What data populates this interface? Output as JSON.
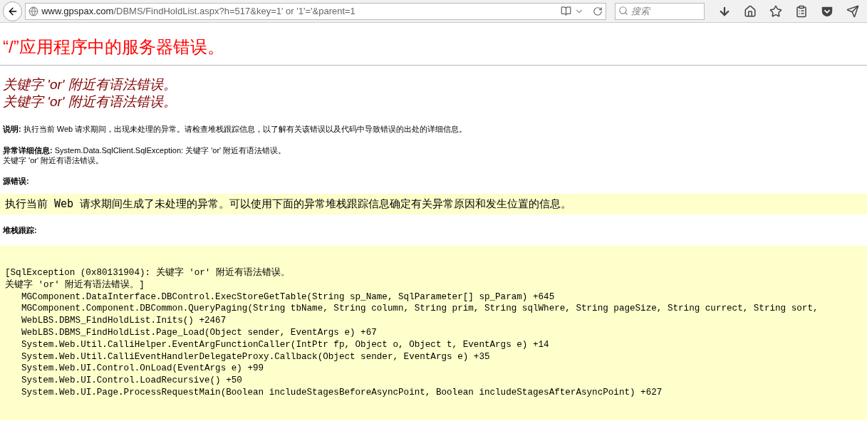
{
  "toolbar": {
    "url": {
      "host": "www.gpspax.com",
      "path": "/DBMS/FindHoldList.aspx?h=517&key=1' or '1'='&parent=1"
    },
    "search": {
      "placeholder": "搜索"
    }
  },
  "page": {
    "title": "“/”应用程序中的服务器错误。",
    "headings": [
      "关键字 'or' 附近有语法错误。",
      "关键字 'or' 附近有语法错误。"
    ],
    "description": "**说明:** 执行当前 Web 请求期间，出现未处理的异常。请检查堆栈跟踪信息，以了解有关该错误以及代码中导致错误的出处的详细信息。",
    "exception_details": [
      "**异常详细信息:** System.Data.SqlClient.SqlException: 关键字 'or' 附近有语法错误。",
      "关键字 'or' 附近有语法错误。"
    ],
    "source_error_label": "源错误:",
    "source_error": "执行当前 Web 请求期间生成了未处理的异常。可以使用下面的异常堆栈跟踪信息确定有关异常原因和发生位置的信息。",
    "stack_trace_label": "堆栈跟踪:",
    "stack_trace": {
      "message": [
        "[SqlException (0x80131904): 关键字 'or' 附近有语法错误。",
        "关键字 'or' 附近有语法错误。]"
      ],
      "frames": [
        "MGComponent.DataInterface.DBControl.ExecStoreGetTable(String sp_Name, SqlParameter[] sp_Param) +645",
        "MGComponent.Component.DBCommon.QueryPaging(String tbName, String column, String prim, String sqlWhere, String pageSize, String currect, String sort,",
        "WebLBS.DBMS_FindHoldList.Inits() +2467",
        "WebLBS.DBMS_FindHoldList.Page_Load(Object sender, EventArgs e) +67",
        "System.Web.Util.CalliHelper.EventArgFunctionCaller(IntPtr fp, Object o, Object t, EventArgs e) +14",
        "System.Web.Util.CalliEventHandlerDelegateProxy.Callback(Object sender, EventArgs e) +35",
        "System.Web.UI.Control.OnLoad(EventArgs e) +99",
        "System.Web.UI.Control.LoadRecursive() +50",
        "System.Web.UI.Page.ProcessRequestMain(Boolean includeStagesBeforeAsyncPoint, Boolean includeStagesAfterAsyncPoint) +627"
      ]
    }
  }
}
